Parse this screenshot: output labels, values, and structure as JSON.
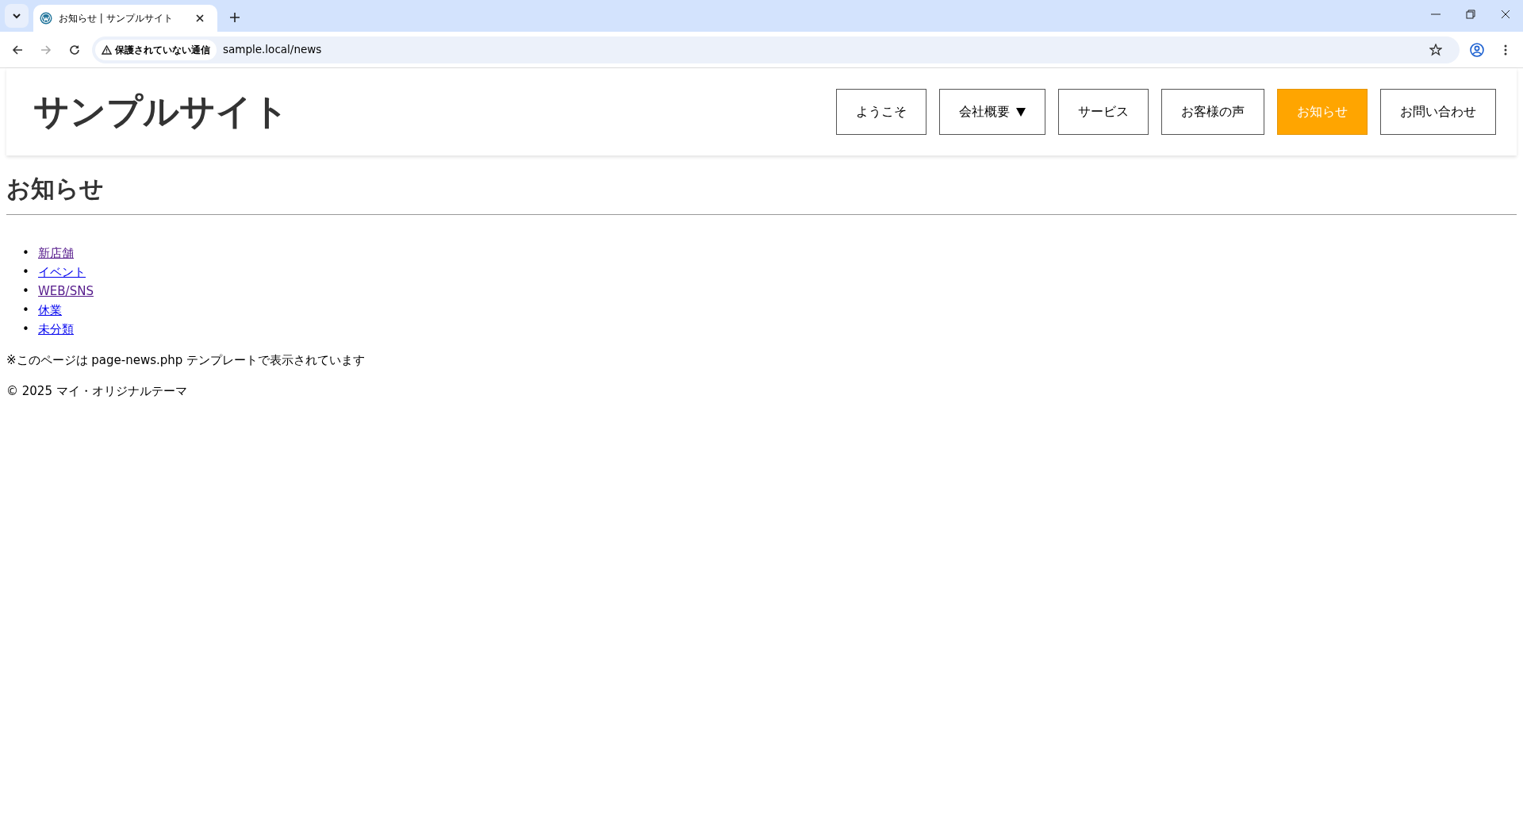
{
  "browser": {
    "tab": {
      "title": "お知らせ | サンプルサイト"
    },
    "address": {
      "security": "保護されていない通信",
      "url": "sample.local/news"
    }
  },
  "header": {
    "logo": "サンプルサイト",
    "nav": [
      {
        "label": "ようこそ",
        "selected": false,
        "dropdown": false
      },
      {
        "label": "会社概要",
        "selected": false,
        "dropdown": true
      },
      {
        "label": "サービス",
        "selected": false,
        "dropdown": false
      },
      {
        "label": "お客様の声",
        "selected": false,
        "dropdown": false
      },
      {
        "label": "お知らせ",
        "selected": true,
        "dropdown": false
      },
      {
        "label": "お問い合わせ",
        "selected": false,
        "dropdown": false
      }
    ]
  },
  "page": {
    "title": "お知らせ",
    "categories": [
      {
        "marker": "•",
        "label": "新店舗",
        "visited": true
      },
      {
        "marker": "•",
        "label": "イベント",
        "visited": false
      },
      {
        "marker": "•",
        "label": "WEB/SNS",
        "visited": true
      },
      {
        "marker": "•",
        "label": "休業",
        "visited": false
      },
      {
        "marker": "•",
        "label": "未分類",
        "visited": false
      }
    ],
    "note": "※このページは page-news.php テンプレートで表示されています"
  },
  "footer": {
    "copyright": "© 2025 マイ・オリジナルテーマ"
  }
}
